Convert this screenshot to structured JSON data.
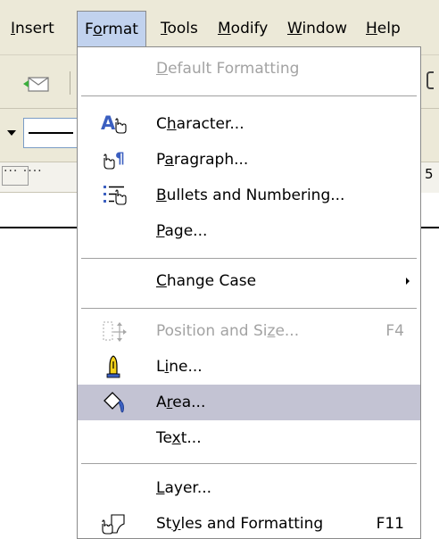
{
  "menubar": {
    "items": [
      {
        "pre": "",
        "u": "I",
        "post": "nsert"
      },
      {
        "pre": "F",
        "u": "o",
        "post": "rmat"
      },
      {
        "pre": "",
        "u": "T",
        "post": "ools"
      },
      {
        "pre": "",
        "u": "M",
        "post": "odify"
      },
      {
        "pre": "",
        "u": "W",
        "post": "indow"
      },
      {
        "pre": "",
        "u": "H",
        "post": "elp"
      }
    ]
  },
  "toolbar": {
    "ruler_text": "··· ····",
    "right_digit": "5"
  },
  "format_menu": {
    "default_formatting": {
      "pre": "",
      "u": "D",
      "post": "efault Formatting"
    },
    "character": {
      "pre": "C",
      "u": "h",
      "post": "aracter..."
    },
    "paragraph": {
      "pre": "P",
      "u": "a",
      "post": "ragraph..."
    },
    "bullets": {
      "pre": "",
      "u": "B",
      "post": "ullets and Numbering..."
    },
    "page": {
      "pre": "",
      "u": "P",
      "post": "age..."
    },
    "change_case": {
      "pre": "",
      "u": "C",
      "post": "hange Case"
    },
    "position_size": {
      "pre": "Position and Si",
      "u": "z",
      "post": "e...",
      "shortcut": "F4"
    },
    "line": {
      "pre": "L",
      "u": "i",
      "post": "ne..."
    },
    "area": {
      "pre": "A",
      "u": "r",
      "post": "ea..."
    },
    "text": {
      "pre": "Te",
      "u": "x",
      "post": "t..."
    },
    "layer": {
      "pre": "",
      "u": "L",
      "post": "ayer..."
    },
    "styles": {
      "pre": "St",
      "u": "y",
      "post": "les and Formatting",
      "shortcut": "F11"
    }
  },
  "colors": {
    "menubar_bg": "#ece9d8",
    "open_menu_bg": "#c1d2ee",
    "highlight_bg": "#c3c3d3",
    "disabled_text": "#a3a3a3"
  },
  "icons": {
    "character": "character-icon",
    "paragraph": "paragraph-icon",
    "bullets": "bullets-icon",
    "position_size": "position-size-icon",
    "line": "line-icon",
    "area": "area-icon",
    "styles": "styles-icon",
    "envelope": "envelope-icon"
  }
}
